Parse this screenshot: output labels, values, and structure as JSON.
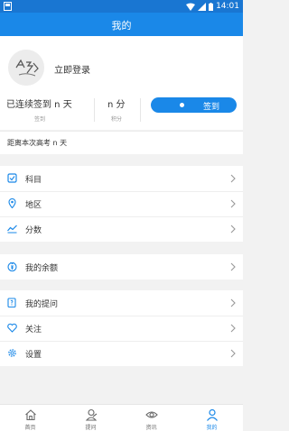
{
  "status_bar": {
    "time": "14:01"
  },
  "app_bar": {
    "title": "我的"
  },
  "profile": {
    "login_text": "立即登录"
  },
  "stats": [
    {
      "value": "已连续签到 n 天",
      "label": "签到"
    },
    {
      "value": "n 分",
      "label": "积分"
    }
  ],
  "sign_button": {
    "label": "签到"
  },
  "countdown": {
    "text": "距离本次高考 n 天"
  },
  "menu_group_1": [
    {
      "label": "科目",
      "icon": "subject-icon"
    },
    {
      "label": "地区",
      "icon": "location-icon"
    },
    {
      "label": "分数",
      "icon": "chart-line-icon"
    }
  ],
  "menu_group_2": [
    {
      "label": "我的余额",
      "icon": "wallet-icon"
    }
  ],
  "menu_group_3": [
    {
      "label": "我的提问",
      "icon": "question-icon"
    },
    {
      "label": "关注",
      "icon": "heart-icon"
    },
    {
      "label": "设置",
      "icon": "gear-icon"
    }
  ],
  "tab_bar": [
    {
      "label": "首页",
      "icon": "home-icon"
    },
    {
      "label": "提问",
      "icon": "ask-icon"
    },
    {
      "label": "资讯",
      "icon": "eye-icon"
    },
    {
      "label": "我的",
      "icon": "user-icon"
    }
  ],
  "colors": {
    "primary": "#1a88e8",
    "status_bar": "#1976d2",
    "background": "#f2f2f2"
  }
}
